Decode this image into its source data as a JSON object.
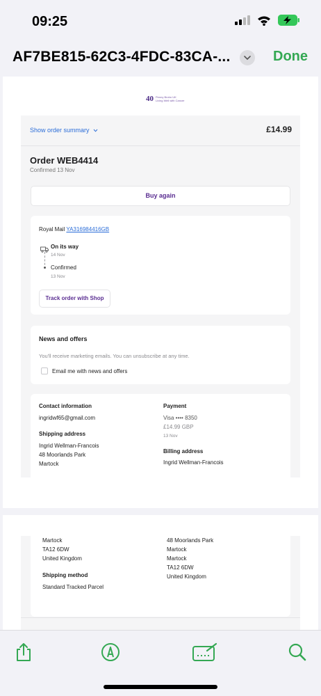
{
  "status": {
    "time": "09:25"
  },
  "nav": {
    "title": "AF7BE815-62C3-4FDC-83CA-...",
    "done": "Done"
  },
  "brand": {
    "mark": "40",
    "line1": "Penny Brohn UK",
    "line2": "Living Well with Cancer"
  },
  "summary": {
    "link": "Show order summary",
    "total": "£14.99"
  },
  "order": {
    "title": "Order WEB4414",
    "subtitle": "Confirmed 13 Nov",
    "buy_again": "Buy again"
  },
  "shipment": {
    "carrier": "Royal Mail",
    "tracking": "YA316984416GB",
    "events": [
      {
        "label": "On its way",
        "date": "14 Nov"
      },
      {
        "label": "Confirmed",
        "date": "13 Nov"
      }
    ],
    "track_button": "Track order with Shop"
  },
  "news": {
    "title": "News and offers",
    "body": "You'll receive marketing emails. You can unsubscribe at any time.",
    "checkbox_label": "Email me with news and offers"
  },
  "contact": {
    "heading": "Contact information",
    "email": "ingridwf65@gmail.com"
  },
  "payment": {
    "heading": "Payment",
    "card": "Visa •••• 8350",
    "amount": "£14.99 GBP",
    "date": "13 Nov"
  },
  "shipping_address": {
    "heading": "Shipping address",
    "lines": [
      "Ingrid Wellman-Francois",
      "48 Moorlands Park",
      "Martock",
      "Martock",
      "TA12 6DW",
      "United Kingdom"
    ]
  },
  "billing_address": {
    "heading": "Billing address",
    "lines": [
      "Ingrid Wellman-Francois",
      "48 Moorlands Park",
      "Martock",
      "Martock",
      "TA12 6DW",
      "United Kingdom"
    ]
  },
  "shipping_method": {
    "heading": "Shipping method",
    "value": "Standard Tracked Parcel"
  },
  "colors": {
    "accent_green": "#34a853",
    "brand_purple": "#5a2d91",
    "link_blue": "#2b6dd8"
  },
  "toolbar": {
    "icons": [
      "share-icon",
      "markup-icon",
      "signature-icon",
      "search-icon"
    ]
  }
}
